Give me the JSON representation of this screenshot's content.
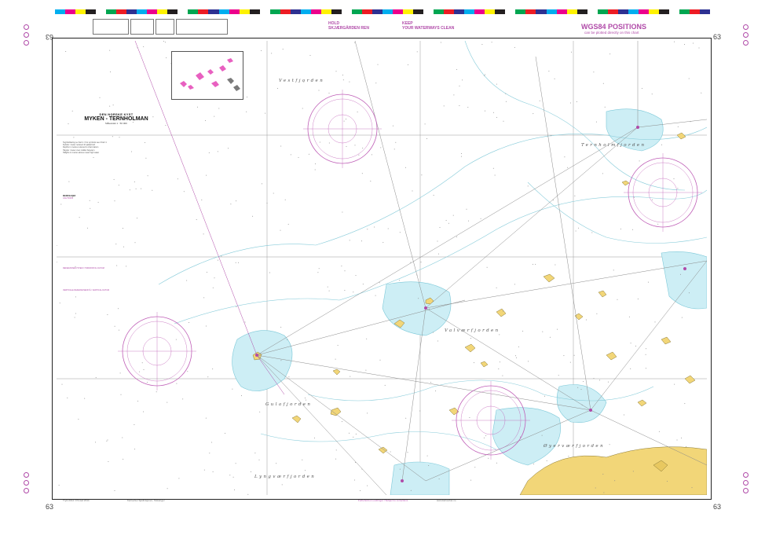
{
  "chart": {
    "number": "63",
    "title_line1": "DEN NORSKE KYST",
    "title_line2": "MYKEN - TERNHOLMAN",
    "scale_note": "Målestokk 1 : 50 000"
  },
  "header": {
    "hold_line1": "HOLD",
    "hold_line2": "SKJÆRGÅRDEN REN",
    "keep_line1": "KEEP",
    "keep_line2": "YOUR WATERWAYS CLEAN",
    "wgs_title": "WGS84 POSITIONS",
    "wgs_sub": "can be plotted directly on this chart"
  },
  "places": {
    "vestfjorden": "Vestfjorden",
    "ternholmfjorden": "Ternholmfjorden",
    "valvaerfjorden": "Valværfjorden",
    "gulafjorden": "Gulafjorden",
    "oyervaerfjorden": "Øyerværfjorden",
    "lyngvaerfjorden": "Lyngværfjorden"
  },
  "notes": {
    "heading_a": "MERKNADER",
    "heading_b": "CAUTIONS",
    "heading_c": "REFERANSESYSTEM / HORIZONTAL DATUM",
    "heading_d": "VERTIKALE REFERANSENIVÅ / VERTICAL DATUM",
    "lines": [
      "Tegnforklaring se Kart 1 / For symbols see Chart 1",
      "Dybder i meter redusert til sjøkartnull",
      "Depths in metres reduced to chart datum",
      "Høyder i meter over middel høyvann",
      "Heights in metres above mean high water"
    ]
  },
  "footer": {
    "col1": "Trykt 2014 / Printed 2014",
    "col2": "Kartverket Sjødivisjonen, Stavanger",
    "col3": "Forbehold om endringer / Subject to corrections",
    "col4": "www.kartverket.no"
  },
  "colors": {
    "magenta": "#b04aa8",
    "land": "#f2d678",
    "shallow": "#cdeef5",
    "sea": "#ffffff"
  }
}
